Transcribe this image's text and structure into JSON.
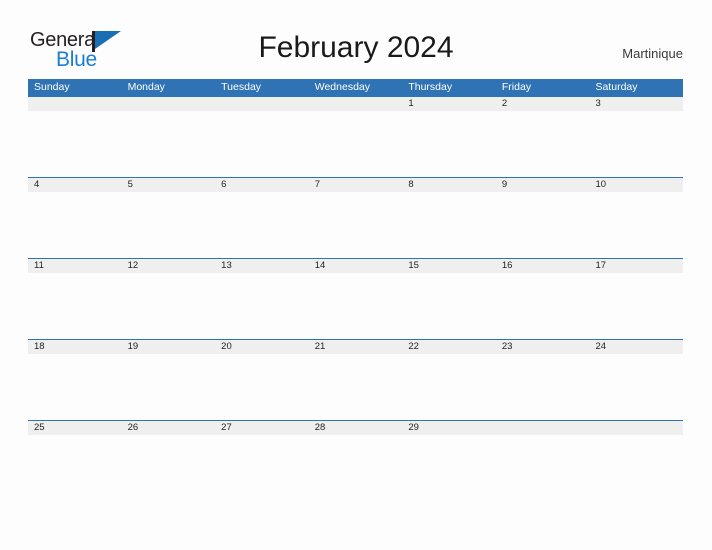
{
  "brand": {
    "name_part1": "General",
    "name_part2": "Blue",
    "flag_icon": "flag-triangle-icon",
    "color_dark": "#231f20",
    "color_blue": "#1a7fd4"
  },
  "header": {
    "title": "February 2024",
    "locale": "Martinique"
  },
  "calendar": {
    "accent_color": "#2f73b4",
    "band_color": "#efefef",
    "weekdays": [
      "Sunday",
      "Monday",
      "Tuesday",
      "Wednesday",
      "Thursday",
      "Friday",
      "Saturday"
    ],
    "weeks": [
      [
        "",
        "",
        "",
        "",
        "1",
        "2",
        "3"
      ],
      [
        "4",
        "5",
        "6",
        "7",
        "8",
        "9",
        "10"
      ],
      [
        "11",
        "12",
        "13",
        "14",
        "15",
        "16",
        "17"
      ],
      [
        "18",
        "19",
        "20",
        "21",
        "22",
        "23",
        "24"
      ],
      [
        "25",
        "26",
        "27",
        "28",
        "29",
        "",
        ""
      ]
    ]
  }
}
